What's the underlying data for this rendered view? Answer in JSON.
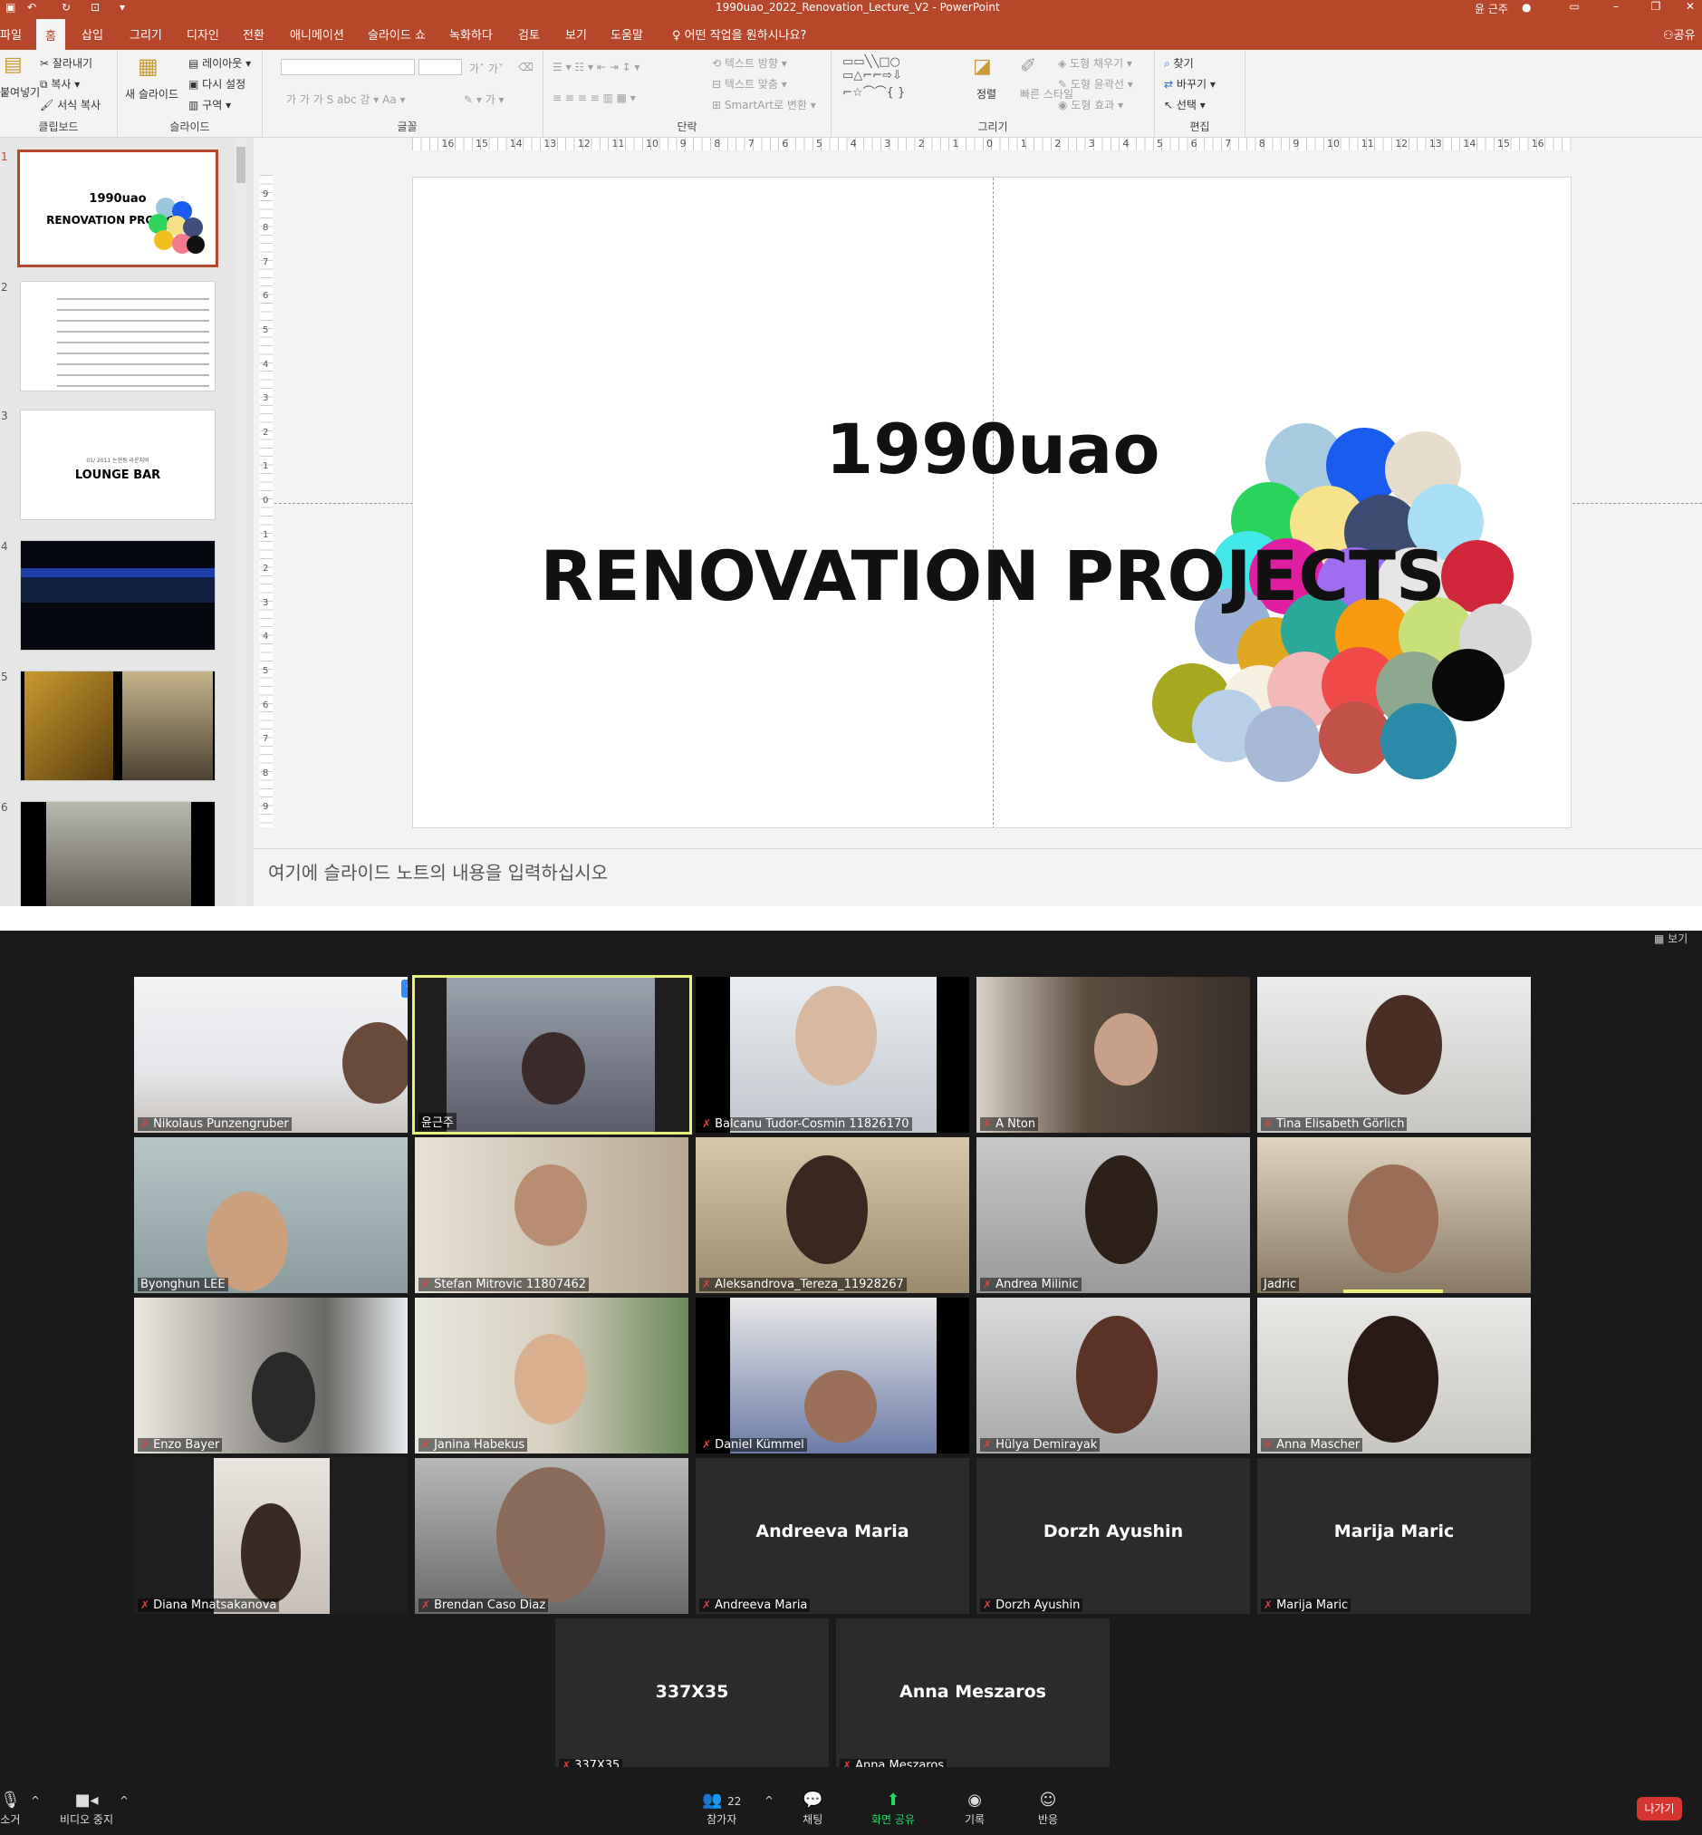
{
  "titlebar": {
    "document": "1990uao_2022_Renovation_Lecture_V2  -  PowerPoint",
    "user": "윤 근주"
  },
  "menu": {
    "items": [
      "파일",
      "홈",
      "삽입",
      "그리기",
      "디자인",
      "전환",
      "애니메이션",
      "슬라이드 쇼",
      "녹화하다",
      "검토",
      "보기",
      "도움말"
    ],
    "tell_me": "어떤 작업을 원하시나요?",
    "share": "공유"
  },
  "ribbon": {
    "clipboard": {
      "paste": "붙여넣기",
      "cut": "잘라내기",
      "copy": "복사",
      "format_painter": "서식 복사",
      "label": "클립보드"
    },
    "slides": {
      "new_slide": "새 슬라이드",
      "layout": "레이아웃",
      "reset": "다시 설정",
      "section": "구역",
      "label": "슬라이드"
    },
    "font": {
      "label": "글꼴"
    },
    "paragraph": {
      "text_direction": "텍스트 방향",
      "align_text": "텍스트 맞춤",
      "smartart": "SmartArt로 변환",
      "label": "단락"
    },
    "drawing": {
      "arrange": "정렬",
      "quick_styles": "빠른 스타일",
      "shape_fill": "도형 채우기",
      "shape_outline": "도형 윤곽선",
      "shape_effects": "도형 효과",
      "label": "그리기"
    },
    "editing": {
      "find": "찾기",
      "replace": "바꾸기",
      "select": "선택",
      "label": "편집"
    }
  },
  "thumbnails": {
    "numbers": [
      "1",
      "2",
      "3",
      "4",
      "5",
      "6"
    ],
    "t1_line1": "1990uao",
    "t1_line2": "RENOVATION PROJECTS",
    "t3_small": "01/ 2011 논현동 라운지바",
    "t3_title": "LOUNGE BAR"
  },
  "slide": {
    "line1": "1990uao",
    "line2": "RENOVATION  PROJECTS"
  },
  "notes_placeholder": "여기에 슬라이드 노트의 내용을 입력하십시오",
  "participants": [
    {
      "name": "Nikolaus Punzengruber"
    },
    {
      "name": "윤근주"
    },
    {
      "name": "Balcanu Tudor-Cosmin 11826170"
    },
    {
      "name": "A Nton"
    },
    {
      "name": "Tina Elisabeth Görlich"
    },
    {
      "name": "Byonghun LEE"
    },
    {
      "name": "Stefan Mitrovic 11807462"
    },
    {
      "name": "Aleksandrova_Tereza_11928267"
    },
    {
      "name": "Andrea Milinic"
    },
    {
      "name": "Jadric"
    },
    {
      "name": "Enzo Bayer"
    },
    {
      "name": "Janina Habekus"
    },
    {
      "name": "Daniel Kümmel"
    },
    {
      "name": "Hülya Demirayak"
    },
    {
      "name": "Anna Mascher"
    },
    {
      "name": "Diana Mnatsakanova"
    },
    {
      "name": "Brendan Caso Diaz"
    },
    {
      "name": "Andreeva Maria"
    },
    {
      "name": "Dorzh Ayushin"
    },
    {
      "name": "Marija Maric"
    },
    {
      "name": "337X35"
    },
    {
      "name": "Anna Meszaros"
    }
  ],
  "zoombar": {
    "mute": "소거",
    "video": "비디오 중지",
    "participants": "참가자",
    "participant_count": "22",
    "chat": "채팅",
    "share": "화면 공유",
    "record": "기록",
    "reactions": "반응",
    "leave": "나가기"
  },
  "colors": {
    "ppt_accent": "#b7472a",
    "zoom_bg": "#1a1a1a",
    "zoom_share": "#2dd46a",
    "leave": "#d6352f"
  }
}
